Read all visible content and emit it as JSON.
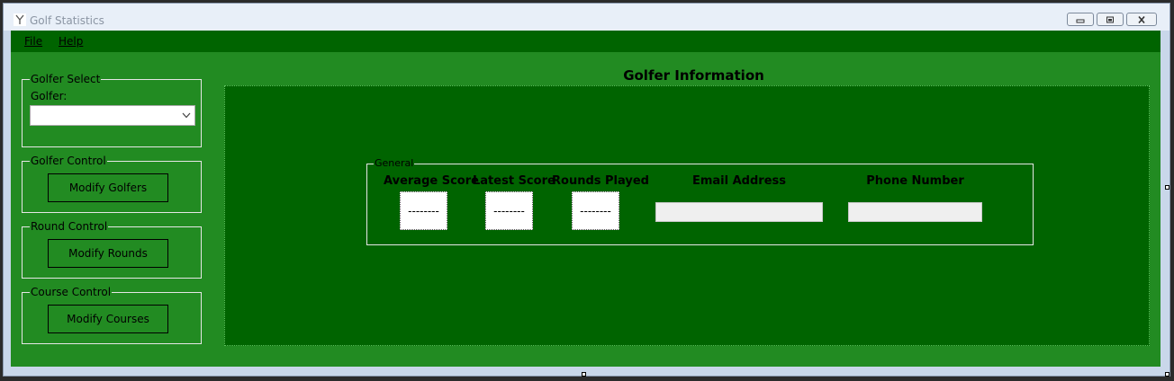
{
  "window": {
    "title": "Golf Statistics"
  },
  "menu": {
    "items": [
      {
        "label": "File"
      },
      {
        "label": "Help"
      }
    ]
  },
  "golfer_select": {
    "legend": "Golfer Select",
    "golfer_label": "Golfer:",
    "golfer_value": ""
  },
  "golfer_control": {
    "legend": "Golfer Control",
    "button": "Modify Golfers"
  },
  "round_control": {
    "legend": "Round Control",
    "button": "Modify Rounds"
  },
  "course_control": {
    "legend": "Course Control",
    "button": "Modify Courses"
  },
  "golfer_info": {
    "title": "Golfer Information",
    "general": {
      "legend": "General",
      "columns": {
        "average_score": {
          "label": "Average Score",
          "value": "--------"
        },
        "latest_score": {
          "label": "Latest Score",
          "value": "--------"
        },
        "rounds_played": {
          "label": "Rounds Played",
          "value": "--------"
        },
        "email": {
          "label": "Email Address",
          "value": ""
        },
        "phone": {
          "label": "Phone Number",
          "value": ""
        }
      }
    }
  },
  "colors": {
    "client_background": "#228b22",
    "menubar_background": "#006400",
    "info_panel_background": "#006400"
  }
}
